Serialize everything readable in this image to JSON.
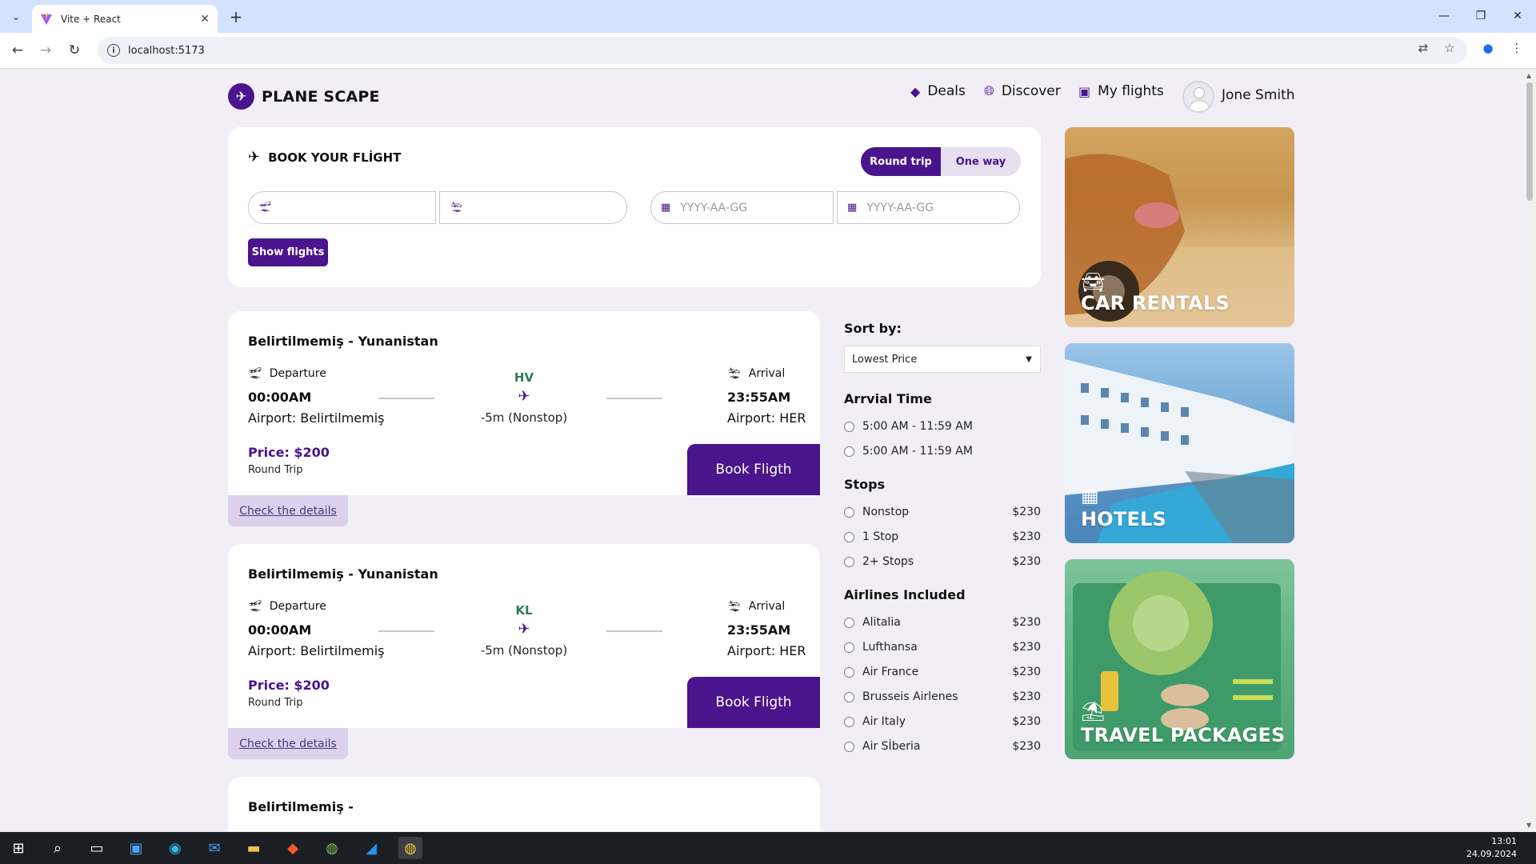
{
  "browser": {
    "tab_title": "Vite + React",
    "url": "localhost:5173",
    "new_tab": "+",
    "close_tab": "✕"
  },
  "brand": {
    "name": "PLANE SCAPE"
  },
  "nav": {
    "deals": "Deals",
    "discover": "Discover",
    "my_flights": "My flights",
    "user": "Jone Smith"
  },
  "booking": {
    "title": "BOOK YOUR FLİGHT",
    "round_trip": "Round trip",
    "one_way": "One way",
    "from_value": "",
    "to_value": "",
    "depart_placeholder": "YYYY-AA-GG",
    "return_placeholder": "YYYY-AA-GG",
    "show_flights": "Show flights",
    "selected_trip": "Round trip"
  },
  "flights": [
    {
      "route": "Belirtilmemiş - Yunanistan",
      "departure_label": "Departure",
      "arrival_label": "Arrival",
      "departure_time": "00:00AM",
      "arrival_time": "23:55AM",
      "departure_airport": "Airport: Belirtilmemiş",
      "arrival_airport": "Airport: HER",
      "airline_code": "HV",
      "duration": "-5m (Nonstop)",
      "price": "Price: $200",
      "trip_type": "Round Trip",
      "book_label": "Book Fligth",
      "details_label": "Check the details"
    },
    {
      "route": "Belirtilmemiş - Yunanistan",
      "departure_label": "Departure",
      "arrival_label": "Arrival",
      "departure_time": "00:00AM",
      "arrival_time": "23:55AM",
      "departure_airport": "Airport: Belirtilmemiş",
      "arrival_airport": "Airport: HER",
      "airline_code": "KL",
      "duration": "-5m (Nonstop)",
      "price": "Price: $200",
      "trip_type": "Round Trip",
      "book_label": "Book Fligth",
      "details_label": "Check the details"
    },
    {
      "route": "Belirtilmemiş -"
    }
  ],
  "filters": {
    "sort_by_label": "Sort by:",
    "sort_value": "Lowest Price",
    "arrival_time_label": "Arrvial Time",
    "arrival_times": [
      "5:00 AM - 11:59 AM",
      "5:00 AM - 11:59 AM"
    ],
    "stops_label": "Stops",
    "stops": [
      {
        "label": "Nonstop",
        "price": "$230"
      },
      {
        "label": "1 Stop",
        "price": "$230"
      },
      {
        "label": "2+ Stops",
        "price": "$230"
      }
    ],
    "airlines_label": "Airlines Included",
    "airlines": [
      {
        "label": "Alitalia",
        "price": "$230"
      },
      {
        "label": "Lufthansa",
        "price": "$230"
      },
      {
        "label": "Air France",
        "price": "$230"
      },
      {
        "label": "Brusseis Airlenes",
        "price": "$230"
      },
      {
        "label": "Air Italy",
        "price": "$230"
      },
      {
        "label": "Air Sİberia",
        "price": "$230"
      }
    ]
  },
  "promos": {
    "car": "CAR RENTALS",
    "hotel": "HOTELS",
    "travel": "TRAVEL PACKAGES"
  },
  "taskbar": {
    "time": "13:01",
    "date": "24.09.2024"
  },
  "colors": {
    "accent": "#4a148c",
    "code_green": "#2e7d57",
    "page_bg": "#f1eff5"
  }
}
